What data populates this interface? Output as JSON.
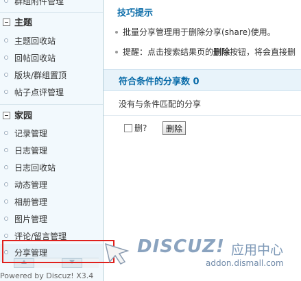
{
  "sidebar": {
    "top_cut_item": "群组附件管理",
    "groups": [
      {
        "title": "主题",
        "items": [
          "主题回收站",
          "回帖回收站",
          "版块/群组置顶",
          "帖子点评管理"
        ]
      },
      {
        "title": "家园",
        "items": [
          "记录管理",
          "日志管理",
          "日志回收站",
          "动态管理",
          "相册管理",
          "图片管理",
          "评论/留言管理",
          "分享管理"
        ]
      }
    ],
    "active_item": "分享管理",
    "scroll_up_icon": "arrow-up-icon",
    "scroll_down_icon": "arrow-down-icon"
  },
  "footer": {
    "powered": "Powered by Discuz! X3.4"
  },
  "main": {
    "tips_title": "技巧提示",
    "tips": [
      {
        "text": "批量分享管理用于删除分享(share)使用。"
      },
      {
        "prefix": "提醒：点击搜索结果页的",
        "bold": "删除",
        "suffix": "按钮，将会直接删"
      }
    ],
    "count_title": "符合条件的分享数 0",
    "empty_text": "没有与条件匹配的分享",
    "delete_checkbox_label": "删?",
    "delete_button": "删除"
  },
  "watermark": {
    "brand": "DISCUZ!",
    "brand_cn": "应用中心",
    "url": "addon.dismall.com"
  },
  "colors": {
    "accent": "#096ba8",
    "sidebar_bg": "#f2f9fd",
    "band_bg": "#e8f3fa",
    "highlight": "#e0201c"
  }
}
